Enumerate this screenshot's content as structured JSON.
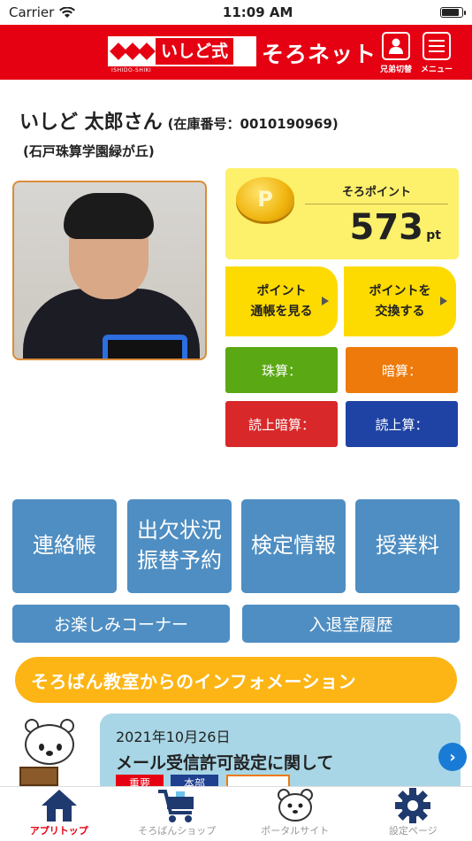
{
  "status_bar": {
    "carrier": "Carrier",
    "time": "11:09 AM"
  },
  "header": {
    "logo_text": "いしど式",
    "logo_sub": "ISHIDO-SHIKI",
    "title": "そろネット",
    "sibling_label": "兄弟切替",
    "menu_label": "メニュー"
  },
  "student": {
    "name": "いしど 太郎さん",
    "number": "(在庫番号：0010190969)",
    "school": "(石戸珠算学園緑が丘)"
  },
  "points": {
    "coin": "P",
    "label": "そろポイント",
    "value": "573",
    "unit": "pt"
  },
  "point_buttons": [
    {
      "line1": "ポイント",
      "line2": "通帳を見る"
    },
    {
      "line1": "ポイントを",
      "line2": "交換する"
    }
  ],
  "skills": [
    {
      "label": "珠算：",
      "color": "#5aa813"
    },
    {
      "label": "暗算：",
      "color": "#ee7a0b"
    },
    {
      "label": "読上暗算：",
      "color": "#d8282a"
    },
    {
      "label": "読上算：",
      "color": "#1f43a4"
    }
  ],
  "main_buttons": [
    {
      "line1": "連絡帳",
      "line2": ""
    },
    {
      "line1": "出欠状況",
      "line2": "振替予約"
    },
    {
      "line1": "検定情報",
      "line2": ""
    },
    {
      "line1": "授業料",
      "line2": ""
    }
  ],
  "wide_buttons": [
    "お楽しみコーナー",
    "入退室履歴"
  ],
  "info": {
    "heading": "そろばん教室からのインフォメーション",
    "news_date": "2021年10月26日",
    "news_title": "メール受信許可設定に関して",
    "tags": [
      {
        "label": "重要",
        "color": "#e50012"
      },
      {
        "label": "本部",
        "color": "#1f3f8f"
      }
    ]
  },
  "tabs": [
    {
      "label": "アプリトップ",
      "icon": "home-icon",
      "active": true
    },
    {
      "label": "そろばんショップ",
      "icon": "cart-icon",
      "active": false
    },
    {
      "label": "ポータルサイト",
      "icon": "bear-icon",
      "active": false
    },
    {
      "label": "設定ページ",
      "icon": "gear-icon",
      "active": false
    }
  ]
}
